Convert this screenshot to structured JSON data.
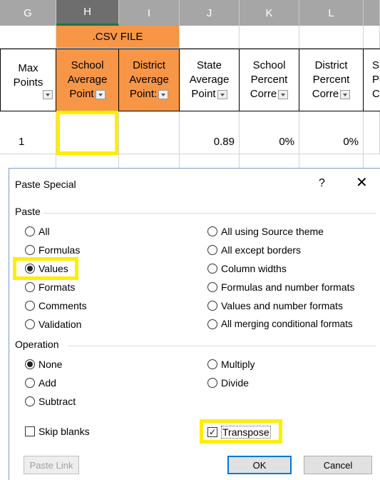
{
  "sheet": {
    "columns": [
      "G",
      "H",
      "I",
      "J",
      "K",
      "L",
      ""
    ],
    "csv_label": ".CSV FILE",
    "max_points": {
      "line1": "Max",
      "line2": "Points"
    },
    "headers": [
      {
        "l1": "School",
        "l2": "Average",
        "l3": "Point"
      },
      {
        "l1": "District",
        "l2": "Average",
        "l3": "Point:"
      },
      {
        "l1": "State",
        "l2": "Average",
        "l3": "Point"
      },
      {
        "l1": "School",
        "l2": "Percent",
        "l3": "Corre"
      },
      {
        "l1": "District",
        "l2": "Percent",
        "l3": "Corre"
      },
      {
        "l1": "S",
        "l2": "Pe",
        "l3": "C"
      }
    ],
    "row": {
      "max_points": "1",
      "state_avg": "0.89",
      "school_pct": "0%",
      "district_pct": "0%"
    }
  },
  "dialog": {
    "title": "Paste Special",
    "help": "?",
    "close": "✕",
    "paste_group": "Paste",
    "paste_options_left": [
      "All",
      "Formulas",
      "Values",
      "Formats",
      "Comments",
      "Validation"
    ],
    "paste_options_right": [
      "All using Source theme",
      "All except borders",
      "Column widths",
      "Formulas and number formats",
      "Values and number formats",
      "All merging conditional formats"
    ],
    "selected_paste": "Values",
    "operation_group": "Operation",
    "operation_left": [
      "None",
      "Add",
      "Subtract"
    ],
    "operation_right": [
      "Multiply",
      "Divide"
    ],
    "selected_operation": "None",
    "skip_blanks": "Skip blanks",
    "transpose": "Transpose",
    "paste_link": "Paste Link",
    "ok": "OK",
    "cancel": "Cancel"
  },
  "colors": {
    "highlight": "#ffee00",
    "orange": "#f79646",
    "accent": "#0078d7"
  }
}
